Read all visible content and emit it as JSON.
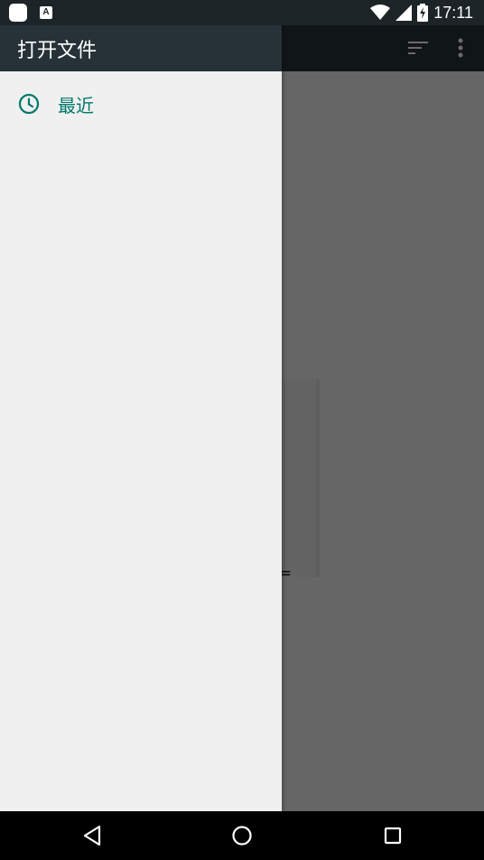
{
  "status_bar": {
    "time": "17:11",
    "notification_font_letter": "A",
    "icons": [
      "app-notification-icon",
      "font-notification-icon",
      "wifi-icon",
      "cell-signal-icon",
      "battery-charging-icon"
    ]
  },
  "app": {
    "toolbar_icons": [
      "sort-icon",
      "more-vert-icon"
    ],
    "empty_label_fragment": "="
  },
  "drawer": {
    "title": "打开文件",
    "items": [
      {
        "label": "最近",
        "icon": "clock-icon"
      }
    ]
  },
  "nav_bar": {
    "buttons": [
      "back-icon",
      "home-icon",
      "recents-icon"
    ]
  },
  "colors": {
    "toolbar": "#263238",
    "accent": "#00796b",
    "drawer_bg": "#f0f0f0",
    "scrim": "#676767"
  }
}
